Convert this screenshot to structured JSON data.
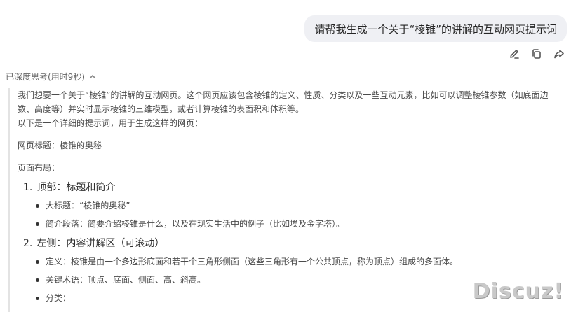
{
  "user_message": "请帮我生成一个关于“棱锥”的讲解的互动网页提示词",
  "message_actions": [
    {
      "name": "edit-icon"
    },
    {
      "name": "copy-icon"
    },
    {
      "name": "share-icon"
    }
  ],
  "thinking": {
    "header": "已深度思考(用时9秒)",
    "para1": "我们想要一个关于“棱锥”的讲解的互动网页。这个网页应该包含棱锥的定义、性质、分类以及一些互动元素，比如可以调整棱锥参数（如底面边数、高度等）并实时显示棱锥的三维模型，或者计算棱锥的表面积和体积等。",
    "para2": "以下是一个详细的提示词，用于生成这样的网页：",
    "title_line": "网页标题：棱锥的奥秘",
    "layout_line": "页面布局：",
    "sections": [
      {
        "number": "1.",
        "heading": "顶部：标题和简介",
        "items": [
          "大标题：“棱锥的奥秘”",
          "简介段落：简要介绍棱锥是什么，以及在现实生活中的例子（比如埃及金字塔）。"
        ]
      },
      {
        "number": "2.",
        "heading": "左侧：内容讲解区（可滚动）",
        "items": [
          "定义：棱锥是由一个多边形底面和若干个三角形侧面（这些三角形有一个公共顶点，称为顶点）组成的多面体。",
          "关键术语：顶点、底面、侧面、高、斜高。",
          "分类："
        ]
      }
    ]
  },
  "watermark": "Discuz!"
}
